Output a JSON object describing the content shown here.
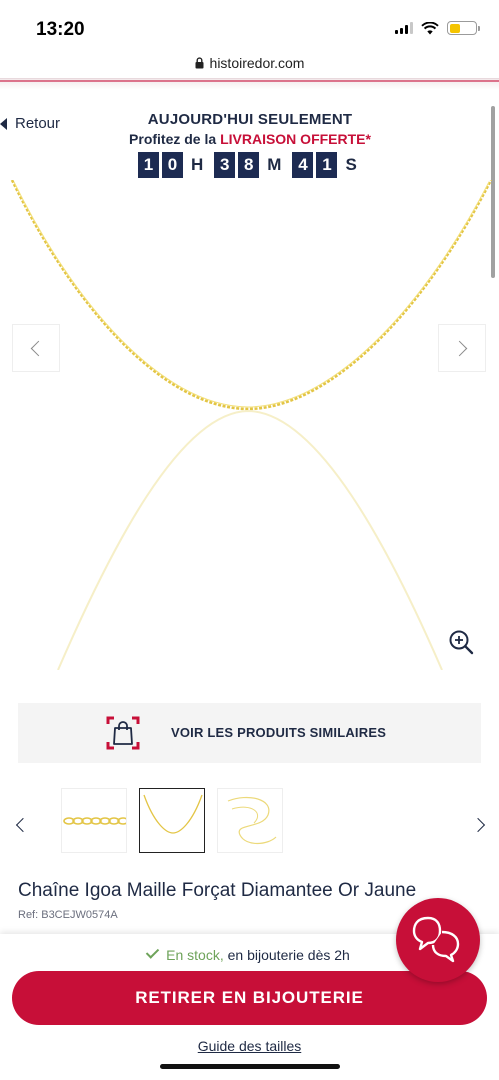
{
  "status_bar": {
    "time": "13:20",
    "icons": [
      "cellular-signal-icon",
      "wifi-icon",
      "battery-icon"
    ],
    "battery_level": 0.42,
    "battery_color": "#f5c400"
  },
  "browser": {
    "url": "histoiredor.com",
    "lock_icon": "lock-icon"
  },
  "header": {
    "back_label": "Retour",
    "promo_title": "AUJOURD'HUI SEULEMENT",
    "promo_prefix": "Profitez de la ",
    "promo_highlight": "LIVRAISON OFFERTE*",
    "countdown": {
      "hours": [
        "1",
        "0"
      ],
      "hours_unit": "H",
      "minutes": [
        "3",
        "8"
      ],
      "minutes_unit": "M",
      "seconds": [
        "4",
        "1"
      ],
      "seconds_unit": "S"
    }
  },
  "gallery": {
    "prev_icon": "chevron-left-icon",
    "next_icon": "chevron-right-icon",
    "zoom_icon": "zoom-in-icon"
  },
  "similar": {
    "label": "VOIR LES PRODUITS SIMILAIRES",
    "icon": "shopping-bag-icon"
  },
  "thumbnails": {
    "items": [
      "chain-links-closeup",
      "chain-necklace",
      "chain-coiled"
    ],
    "active_index": 1
  },
  "product": {
    "title": "Chaîne Igoa Maille Forçat Diamantee Or Jaune",
    "ref": "Ref: B3CEJW0574A"
  },
  "footer": {
    "stock_status": "En stock,",
    "stock_detail": " en bijouterie dès 2h",
    "cta_label": "RETIRER EN BIJOUTERIE",
    "guide_label": "Guide des tailles"
  },
  "colors": {
    "brand_red": "#c70f38",
    "navy": "#1f2a44",
    "countdown_bg": "#1d2b52",
    "gold": "#e3c545",
    "stock_green": "#6ea35a"
  }
}
